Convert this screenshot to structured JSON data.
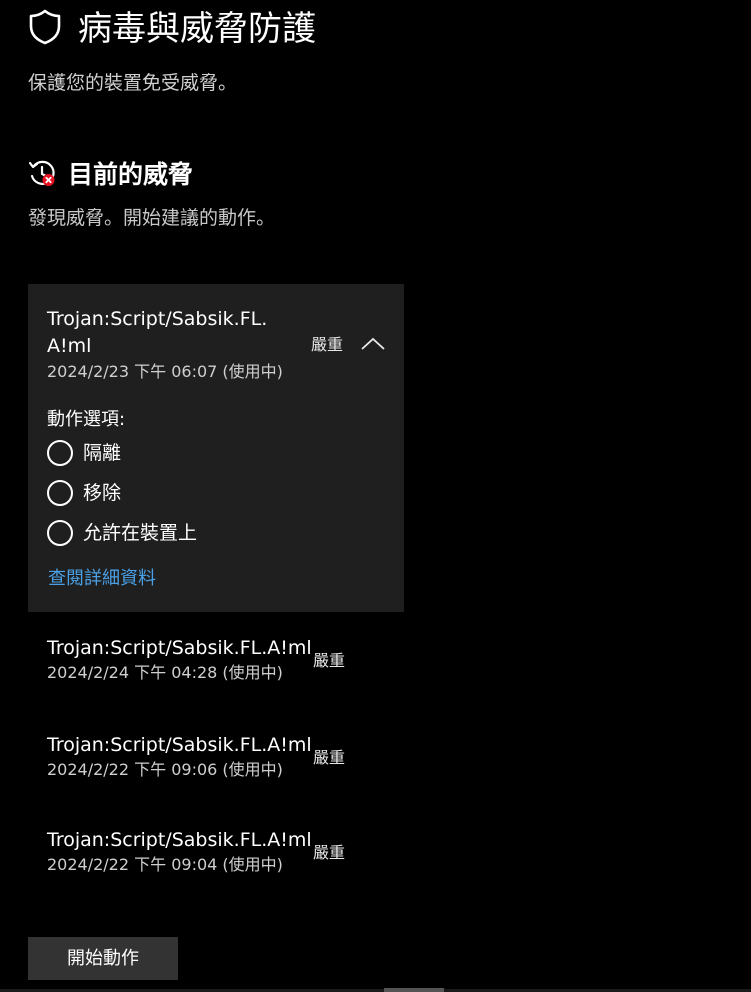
{
  "header": {
    "title": "病毒與威脅防護",
    "subtitle": "保護您的裝置免受威脅。",
    "icon": "shield-icon"
  },
  "current_threats": {
    "title": "目前的威脅",
    "description": "發現威脅。開始建議的動作。",
    "icon": "history-threat-icon",
    "status_color": "#e81123"
  },
  "expanded_threat": {
    "name": "Trojan:Script/Sabsik.FL.A!ml",
    "time": "2024/2/23 下午 06:07 (使用中)",
    "severity": "嚴重",
    "actions_label": "動作選項:",
    "options": [
      "隔離",
      "移除",
      "允許在裝置上"
    ],
    "details_link": "查閱詳細資料",
    "link_color": "#4aa0e6"
  },
  "threats": [
    {
      "name": "Trojan:Script/Sabsik.FL.A!ml",
      "time": "2024/2/24 下午 04:28 (使用中)",
      "severity": "嚴重"
    },
    {
      "name": "Trojan:Script/Sabsik.FL.A!ml",
      "time": "2024/2/22 下午 09:06 (使用中)",
      "severity": "嚴重"
    },
    {
      "name": "Trojan:Script/Sabsik.FL.A!ml",
      "time": "2024/2/22 下午 09:04 (使用中)",
      "severity": "嚴重"
    }
  ],
  "start_action_label": "開始動作"
}
